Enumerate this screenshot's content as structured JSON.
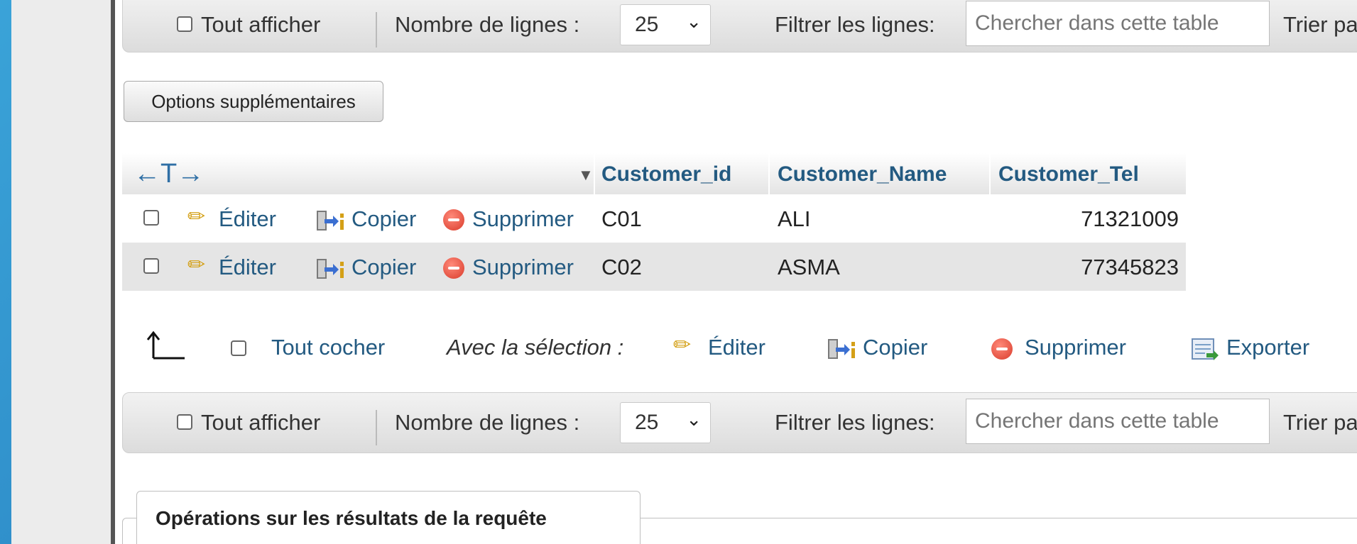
{
  "navbar": {
    "show_all_label": "Tout afficher",
    "rows_label": "Nombre de lignes :",
    "rows_value": "25",
    "filter_label": "Filtrer les lignes:",
    "search_placeholder": "Chercher dans cette table",
    "sort_label": "Trier pa"
  },
  "options_button": "Options supplémentaires",
  "table": {
    "columns": [
      "Customer_id",
      "Customer_Name",
      "Customer_Tel"
    ],
    "action_labels": {
      "edit": "Éditer",
      "copy": "Copier",
      "delete": "Supprimer"
    },
    "rows": [
      {
        "id": "C01",
        "name": "ALI",
        "tel": "71321009"
      },
      {
        "id": "C02",
        "name": "ASMA",
        "tel": "77345823"
      }
    ]
  },
  "bulk": {
    "check_all": "Tout cocher",
    "with_selection": "Avec la sélection :",
    "edit": "Éditer",
    "copy": "Copier",
    "delete": "Supprimer",
    "export": "Exporter"
  },
  "query_ops_tab": "Opérations sur les résultats de la requête",
  "colors": {
    "link": "#235a81",
    "delete": "#d93b2b",
    "edit_pencil": "#d4a017"
  }
}
